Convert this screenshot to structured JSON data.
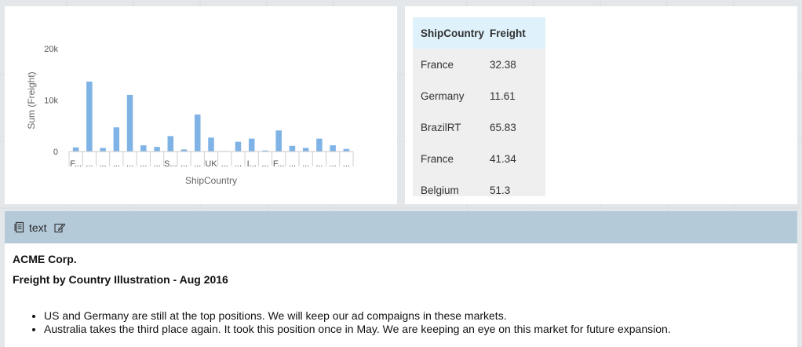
{
  "chart_data": {
    "type": "bar",
    "xlabel": "ShipCountry",
    "ylabel": "Sum (Freight)",
    "ylim": [
      0,
      20000
    ],
    "yticks": [
      "0",
      "10k",
      "20k"
    ],
    "color": "#7fb3e6",
    "categories": [
      "F...",
      "...",
      "...",
      "...",
      "...",
      "...",
      "...",
      "S...",
      "...",
      "...",
      "UK",
      "...",
      "...",
      "I...",
      "...",
      "F...",
      "...",
      "...",
      "...",
      "...",
      "..."
    ],
    "values": [
      800,
      13600,
      700,
      4700,
      11000,
      1200,
      900,
      3000,
      400,
      7200,
      2700,
      100,
      1900,
      2500,
      200,
      4100,
      1100,
      700,
      2500,
      1200,
      500
    ]
  },
  "table": {
    "headers": [
      "ShipCountry",
      "Freight"
    ],
    "rows": [
      [
        "France",
        "32.38"
      ],
      [
        "Germany",
        "11.61"
      ],
      [
        "BrazilRT",
        "65.83"
      ],
      [
        "France",
        "41.34"
      ],
      [
        "Belgium",
        "51.3"
      ]
    ]
  },
  "text_panel": {
    "header_label": "text",
    "title": "ACME Corp.",
    "subtitle": "Freight by Country Illustration - Aug 2016",
    "bullets": [
      "US and Germany are still at the top positions. We will keep our ad compaigns in these markets.",
      "Australia takes the third place again. It took this position once in May. We are keeping an eye on this market for future expansion."
    ],
    "icons": {
      "doc": "document-icon",
      "edit": "edit-icon"
    },
    "header_color": "#b4cad9"
  }
}
